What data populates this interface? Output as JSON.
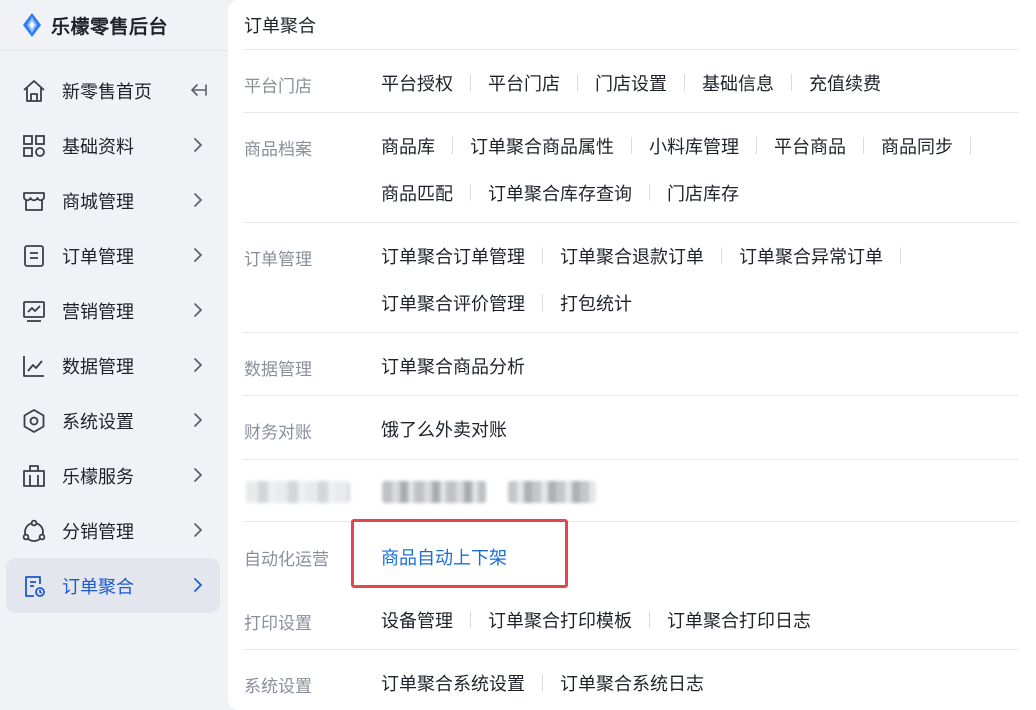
{
  "app": {
    "title": "乐檬零售后台"
  },
  "sidebar": {
    "items": [
      {
        "label": "新零售首页",
        "icon": "home-icon"
      },
      {
        "label": "基础资料",
        "icon": "grid-icon"
      },
      {
        "label": "商城管理",
        "icon": "store-icon"
      },
      {
        "label": "订单管理",
        "icon": "document-icon"
      },
      {
        "label": "营销管理",
        "icon": "monitor-chart-icon"
      },
      {
        "label": "数据管理",
        "icon": "line-chart-icon"
      },
      {
        "label": "系统设置",
        "icon": "hexagon-settings-icon"
      },
      {
        "label": "乐檬服务",
        "icon": "building-icon"
      },
      {
        "label": "分销管理",
        "icon": "share-network-icon"
      },
      {
        "label": "订单聚合",
        "icon": "order-aggregate-icon",
        "active": true
      }
    ]
  },
  "panel": {
    "title": "订单聚合",
    "sections": [
      {
        "category": "平台门店",
        "rows": [
          [
            "平台授权",
            "平台门店",
            "门店设置",
            "基础信息",
            "充值续费"
          ]
        ]
      },
      {
        "category": "商品档案",
        "rows": [
          [
            "商品库",
            "订单聚合商品属性",
            "小料库管理",
            "平台商品",
            "商品同步"
          ],
          [
            "商品匹配",
            "订单聚合库存查询",
            "门店库存"
          ]
        ]
      },
      {
        "category": "订单管理",
        "rows": [
          [
            "订单聚合订单管理",
            "订单聚合退款订单",
            "订单聚合异常订单"
          ],
          [
            "订单聚合评价管理",
            "打包统计"
          ]
        ]
      },
      {
        "category": "数据管理",
        "rows": [
          [
            "订单聚合商品分析"
          ]
        ]
      },
      {
        "category": "财务对账",
        "rows": [
          [
            "饿了么外卖对账"
          ]
        ]
      },
      {
        "category": "自动化运营",
        "rows": [
          [
            "商品自动上下架"
          ]
        ]
      },
      {
        "category": "打印设置",
        "rows": [
          [
            "设备管理",
            "订单聚合打印模板",
            "订单聚合打印日志"
          ]
        ]
      },
      {
        "category": "系统设置",
        "rows": [
          [
            "订单聚合系统设置",
            "订单聚合系统日志"
          ]
        ]
      }
    ]
  },
  "colors": {
    "accent": "#1a6ed9",
    "highlight_border": "#e2474f",
    "category_text": "#8a8f98"
  }
}
